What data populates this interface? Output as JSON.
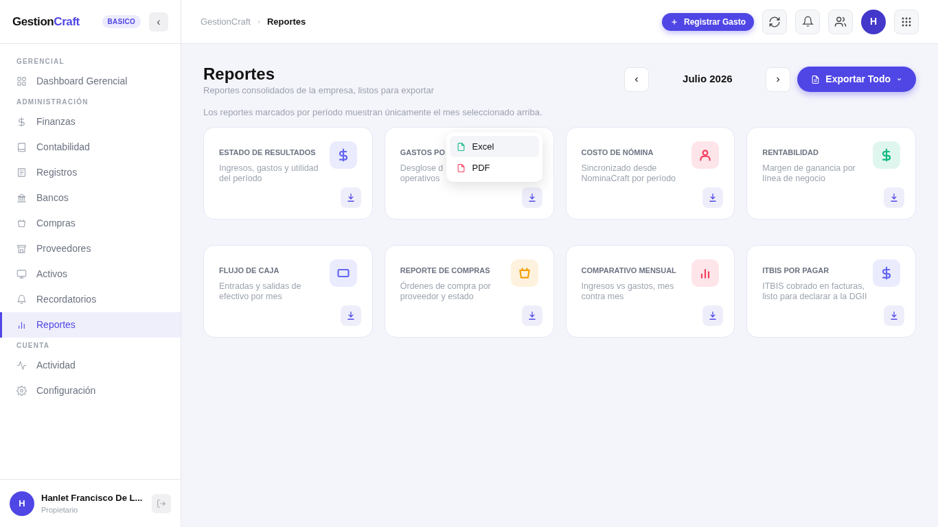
{
  "sidebar": {
    "brand": {
      "part_1": "Gestion",
      "part_2": "Craft"
    },
    "plan_badge": "BASICO",
    "collapse_button": "‹",
    "sections": [
      {
        "heading": "GERENCIAL",
        "items": [
          {
            "label": "Dashboard Gerencial",
            "kind": "grid",
            "selected": false
          }
        ]
      },
      {
        "heading": "ADMINISTRACIÓN",
        "items": [
          {
            "label": "Finanzas",
            "kind": "dollar",
            "selected": false
          },
          {
            "label": "Contabilidad",
            "kind": "book",
            "selected": false
          },
          {
            "label": "Registros",
            "kind": "doc",
            "selected": false
          },
          {
            "label": "Bancos",
            "kind": "bank",
            "selected": false
          },
          {
            "label": "Compras",
            "kind": "basket",
            "selected": false
          },
          {
            "label": "Proveedores",
            "kind": "store",
            "selected": false
          },
          {
            "label": "Activos",
            "kind": "monitor",
            "selected": false
          },
          {
            "label": "Recordatorios",
            "kind": "bell",
            "selected": false
          },
          {
            "label": "Reportes",
            "kind": "chart",
            "selected": true
          }
        ]
      },
      {
        "heading": "CUENTA",
        "items": [
          {
            "label": "Actividad",
            "kind": "pulse",
            "selected": false
          },
          {
            "label": "Configuración",
            "kind": "gear",
            "selected": false
          }
        ]
      }
    ],
    "user": {
      "initial": "H",
      "name": "Hanlet Francisco De L...",
      "role": "Propietario"
    }
  },
  "header": {
    "breadcrumb": [
      "GestionCraft",
      "Reportes"
    ],
    "primary_button": "Registrar Gasto",
    "avatar": "H"
  },
  "page": {
    "title": "Reportes",
    "subtitle": "Reportes consolidados de la empresa, listos para exportar",
    "note": "Los reportes marcados por período muestran únicamente el mes seleccionado arriba.",
    "period": "Julio 2026",
    "export_button": "Exportar Todo"
  },
  "cards": [
    {
      "title": "ESTADO DE RESULTADOS",
      "description_lines": [
        "Ingresos, gastos y utilidad",
        "del período"
      ],
      "kind": "dollar",
      "color": "#6366f1"
    },
    {
      "title": "GASTOS PO",
      "description_lines": [
        "Desglose d",
        "operativos"
      ],
      "export_menu": [
        {
          "label": "Excel",
          "color": "#10b981"
        },
        {
          "label": "PDF",
          "color": "#f43f5e"
        }
      ]
    },
    {
      "title": "COSTO DE NÓMINA",
      "description_lines": [
        "Sincronizado desde",
        "NominaCraft por período"
      ],
      "kind": "user",
      "color": "#f43f5e"
    },
    {
      "title": "RENTABILIDAD",
      "description_lines": [
        "Margen de ganancia por",
        "línea de negocio"
      ],
      "kind": "dollar",
      "color": "#10b981"
    },
    {
      "title": "FLUJO DE CAJA",
      "description_lines": [
        "Entradas y salidas de",
        "efectivo por mes"
      ],
      "kind": "rect",
      "color": "#6366f1"
    },
    {
      "title": "REPORTE DE COMPRAS",
      "description_lines": [
        "Órdenes de compra por",
        "proveedor y estado"
      ],
      "kind": "basket",
      "color": "#f59e0b"
    },
    {
      "title": "COMPARATIVO MENSUAL",
      "description_lines": [
        "Ingresos vs gastos, mes",
        "contra mes"
      ],
      "kind": "chart",
      "color": "#f43f5e"
    },
    {
      "title": "ITBIS POR PAGAR",
      "description_lines": [
        "ITBIS cobrado en facturas,",
        "listo para declarar a la DGII"
      ],
      "kind": "dollar",
      "color": "#6366f1"
    }
  ]
}
